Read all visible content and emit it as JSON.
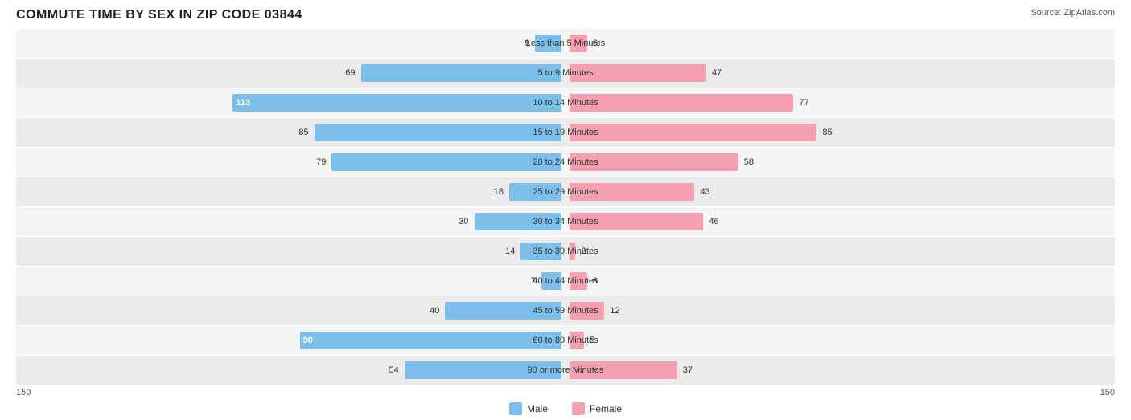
{
  "title": "COMMUTE TIME BY SEX IN ZIP CODE 03844",
  "source": "Source: ZipAtlas.com",
  "max_value": 150,
  "colors": {
    "male": "#7bbfea",
    "female": "#f4a0b0",
    "axis": "#555",
    "bg_odd": "#f5f5f5",
    "bg_even": "#ebebeb"
  },
  "legend": {
    "male_label": "Male",
    "female_label": "Female"
  },
  "axis": {
    "left": "150",
    "right": "150"
  },
  "rows": [
    {
      "label": "Less than 5 Minutes",
      "male": 9,
      "female": 6
    },
    {
      "label": "5 to 9 Minutes",
      "male": 69,
      "female": 47
    },
    {
      "label": "10 to 14 Minutes",
      "male": 113,
      "female": 77
    },
    {
      "label": "15 to 19 Minutes",
      "male": 85,
      "female": 85
    },
    {
      "label": "20 to 24 Minutes",
      "male": 79,
      "female": 58
    },
    {
      "label": "25 to 29 Minutes",
      "male": 18,
      "female": 43
    },
    {
      "label": "30 to 34 Minutes",
      "male": 30,
      "female": 46
    },
    {
      "label": "35 to 39 Minutes",
      "male": 14,
      "female": 2
    },
    {
      "label": "40 to 44 Minutes",
      "male": 7,
      "female": 6
    },
    {
      "label": "45 to 59 Minutes",
      "male": 40,
      "female": 12
    },
    {
      "label": "60 to 89 Minutes",
      "male": 90,
      "female": 5
    },
    {
      "label": "90 or more Minutes",
      "male": 54,
      "female": 37
    }
  ]
}
